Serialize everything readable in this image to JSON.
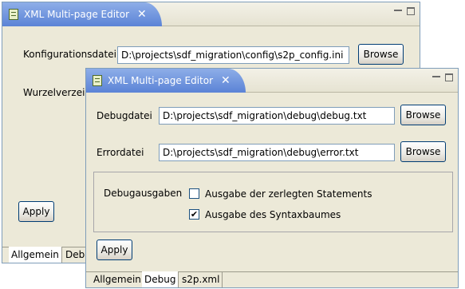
{
  "back_window": {
    "tab_title": "XML Multi-page Editor",
    "close_glyph": "✕",
    "config_label": "Konfigurationsdatei",
    "config_value": "D:\\projects\\sdf_migration\\config\\s2p_config.ini",
    "browse_label": "Browse",
    "root_label": "Wurzelverzeic",
    "apply_label": "Apply",
    "tabs": [
      "Allgemein",
      "Deb"
    ]
  },
  "front_window": {
    "tab_title": "XML Multi-page Editor",
    "close_glyph": "✕",
    "debug_label": "Debugdatei",
    "debug_value": "D:\\projects\\sdf_migration\\debug\\debug.txt",
    "error_label": "Errordatei",
    "error_value": "D:\\projects\\sdf_migration\\debug\\error.txt",
    "browse_label": "Browse",
    "group_label": "Debugausgaben",
    "checkbox1_label": "Ausgabe der zerlegten Statements",
    "checkbox1_checked": false,
    "checkbox2_label": "Ausgabe des Syntaxbaumes",
    "checkbox2_checked": true,
    "check_glyph": "✔",
    "apply_label": "Apply",
    "tabs": [
      "Allgemein",
      "Debug",
      "s2p.xml"
    ]
  },
  "colors": {
    "tab_gradient_top": "#8eaee8",
    "tab_gradient_bottom": "#5b83d6",
    "panel": "#ece9d8"
  }
}
